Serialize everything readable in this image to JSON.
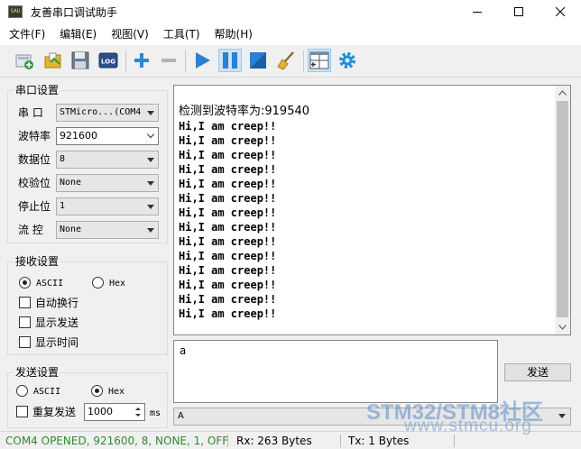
{
  "window": {
    "title": "友善串口调试助手",
    "app_icon_text": "SAU"
  },
  "menu": [
    {
      "label": "文件(F)"
    },
    {
      "label": "编辑(E)"
    },
    {
      "label": "视图(V)"
    },
    {
      "label": "工具(T)"
    },
    {
      "label": "帮助(H)"
    }
  ],
  "toolbar": {
    "log_label": "LOG"
  },
  "serial_settings": {
    "title": "串口设置",
    "port_label": "串  口",
    "port_value": "STMicro...(COM4",
    "baud_label": "波特率",
    "baud_value": "921600",
    "databits_label": "数据位",
    "databits_value": "8",
    "parity_label": "校验位",
    "parity_value": "None",
    "stopbits_label": "停止位",
    "stopbits_value": "1",
    "flow_label": "流  控",
    "flow_value": "None"
  },
  "receive_settings": {
    "title": "接收设置",
    "ascii_label": "ASCII",
    "hex_label": "Hex",
    "auto_newline_label": "自动换行",
    "show_send_label": "显示发送",
    "show_time_label": "显示时间"
  },
  "send_settings": {
    "title": "发送设置",
    "ascii_label": "ASCII",
    "hex_label": "Hex",
    "repeat_label": "重复发送",
    "repeat_value": "1000",
    "unit": "ms"
  },
  "receive_area": {
    "header": "检测到波特率为:919540",
    "lines": [
      "Hi,I am creep!!",
      "Hi,I am creep!!",
      "Hi,I am creep!!",
      "Hi,I am creep!!",
      "Hi,I am creep!!",
      "Hi,I am creep!!",
      "Hi,I am creep!!",
      "Hi,I am creep!!",
      "Hi,I am creep!!",
      "Hi,I am creep!!",
      "Hi,I am creep!!",
      "Hi,I am creep!!",
      "Hi,I am creep!!",
      "Hi,I am creep!!"
    ]
  },
  "send_area": {
    "value": "a",
    "send_label": "发送",
    "history_value": "A"
  },
  "status": {
    "connection": "COM4 OPENED, 921600, 8, NONE, 1, OFF",
    "rx": "Rx: 263 Bytes",
    "tx": "Tx: 1 Bytes",
    "connection_color": "#2e8b2e"
  },
  "watermark": {
    "line1": "STM32/STM8社区",
    "line2": "www.stmcu.org"
  }
}
